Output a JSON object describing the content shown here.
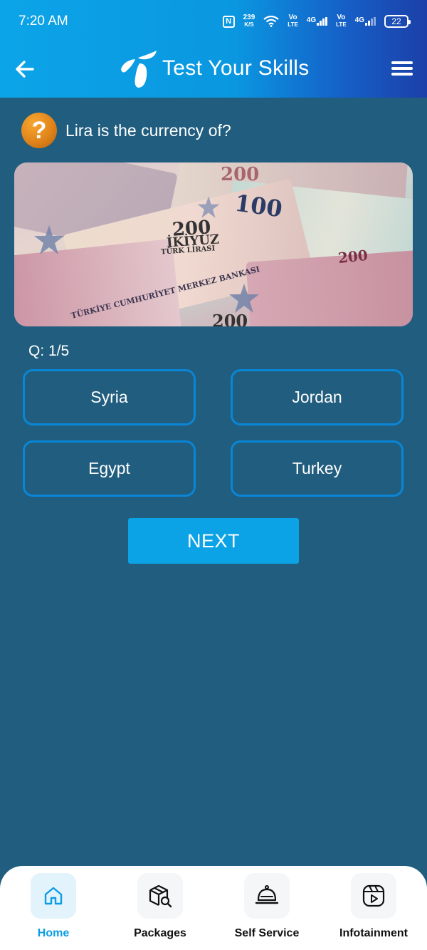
{
  "status_bar": {
    "time": "7:20 AM",
    "net_speed_value": "239",
    "net_speed_unit": "K/S",
    "sim1_label_top": "Vo",
    "sim1_label_bottom": "LTE",
    "sim1_gen": "4G",
    "sim2_label_top": "Vo",
    "sim2_label_bottom": "LTE",
    "sim2_gen": "4G",
    "battery": "22",
    "nfc": "N"
  },
  "app_bar": {
    "title": "Test Your Skills",
    "back_icon": "arrow-left-icon",
    "menu_icon": "hamburger-menu-icon",
    "logo": "telenor-logo"
  },
  "quiz": {
    "question": "Lira is the currency of?",
    "question_icon": "question-mark-icon",
    "counter": "Q: 1/5",
    "options": [
      "Syria",
      "Jordan",
      "Egypt",
      "Turkey"
    ],
    "next_label": "NEXT"
  },
  "banner": {
    "note_200_a": "200",
    "note_100_a": "100",
    "note_200_b": "200",
    "ikiyuz": "İKİYÜZ",
    "turk_lirasi": "TÜRK LİRASI",
    "bank_text": "TÜRKİYE CUMHURİYET MERKEZ BANKASI",
    "note_200_c": "200",
    "note_200_d": "200"
  },
  "bottom_nav": {
    "items": [
      {
        "label": "Home",
        "icon": "home-icon"
      },
      {
        "label": "Packages",
        "icon": "package-search-icon"
      },
      {
        "label": "Self Service",
        "icon": "service-bell-icon"
      },
      {
        "label": "Infotainment",
        "icon": "video-play-icon"
      }
    ]
  },
  "colors": {
    "background": "#215d7e",
    "header_start": "#0ca4e8",
    "header_end": "#1c3fa8",
    "option_border": "#0a86d6",
    "next_button": "#0ca3e6",
    "active_nav": "#0a9de3"
  }
}
